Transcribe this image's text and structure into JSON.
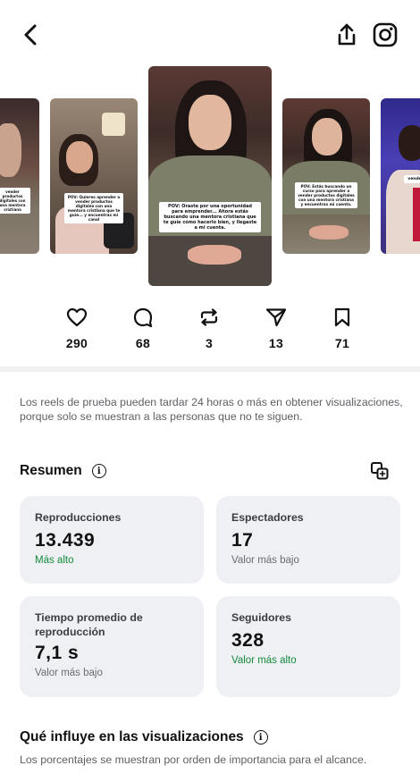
{
  "header": {
    "back_icon": "chevron-left-icon",
    "share_icon": "share-upload-icon",
    "instagram_icon": "instagram-icon"
  },
  "carousel": {
    "thumbnails": [
      {
        "caption": "vender productos digitales con una mentora cristiana"
      },
      {
        "caption": "POV: Quieres aprender a vender productos digitales con una mentora cristiana que te guíe... y encuentras mi canal"
      },
      {
        "caption": "POV: Oraste por una oportunidad para emprender... Ahora estás buscando una mentora cristiana que te guíe cómo hacerlo bien, y llegaste a mi cuenta."
      },
      {
        "caption": "POV: Estás buscando un curso para aprender a vender productos digitales con una mentora cristiana y encuentras mi cuenta."
      },
      {
        "caption": "vende"
      }
    ]
  },
  "actions": {
    "likes": "290",
    "comments": "68",
    "reposts": "3",
    "shares": "13",
    "saves": "71"
  },
  "notice": "Los reels de prueba pueden tardar 24 horas o más en obtener visualizaciones, porque solo se muestran a las personas que no te siguen.",
  "summary": {
    "title": "Resumen",
    "cards": [
      {
        "label": "Reproducciones",
        "value": "13.439",
        "note": "Más alto"
      },
      {
        "label": "Espectadores",
        "value": "17",
        "note": "Valor más bajo"
      },
      {
        "label": "Tiempo promedio de reproducción",
        "value": "7,1 s",
        "note": "Valor más bajo"
      },
      {
        "label": "Seguidores",
        "value": "328",
        "note": "Valor más alto"
      }
    ]
  },
  "influence": {
    "title": "Qué influye en las visualizaciones",
    "subtitle": "Los porcentajes se muestran por orden de importancia para el alcance."
  },
  "colors": {
    "accent_green": "#138a3a",
    "card_bg": "#eef0f4",
    "muted_text": "#5f6066"
  }
}
